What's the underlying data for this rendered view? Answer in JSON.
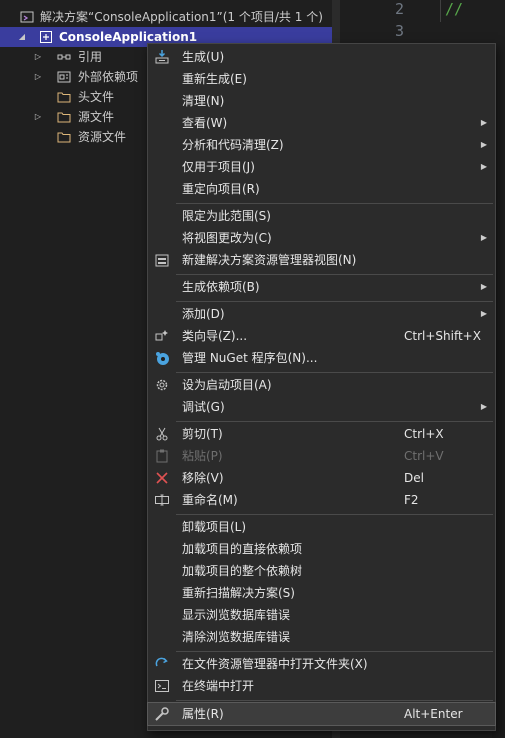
{
  "explorer": {
    "solution_label": "解决方案“ConsoleApplication1”(1 个项目/共 1 个)",
    "project_label": "ConsoleApplication1",
    "nodes": [
      {
        "label": "引用"
      },
      {
        "label": "外部依赖项"
      },
      {
        "label": "头文件"
      },
      {
        "label": "源文件"
      },
      {
        "label": "资源文件"
      }
    ]
  },
  "editor": {
    "line_numbers": [
      "2",
      "3"
    ],
    "comment_fragment": "//"
  },
  "menu": {
    "items": [
      {
        "label": "生成(U)",
        "shortcut": "",
        "icon": "build-icon"
      },
      {
        "label": "重新生成(E)",
        "shortcut": ""
      },
      {
        "label": "清理(N)",
        "shortcut": ""
      },
      {
        "label": "查看(W)",
        "shortcut": "",
        "submenu": true
      },
      {
        "label": "分析和代码清理(Z)",
        "shortcut": "",
        "submenu": true
      },
      {
        "label": "仅用于项目(J)",
        "shortcut": "",
        "submenu": true
      },
      {
        "label": "重定向项目(R)",
        "shortcut": ""
      },
      {
        "label": "限定为此范围(S)",
        "shortcut": ""
      },
      {
        "label": "将视图更改为(C)",
        "shortcut": "",
        "submenu": true
      },
      {
        "label": "新建解决方案资源管理器视图(N)",
        "shortcut": "",
        "icon": "new-view-icon"
      },
      {
        "label": "生成依赖项(B)",
        "shortcut": "",
        "submenu": true
      },
      {
        "label": "添加(D)",
        "shortcut": "",
        "submenu": true
      },
      {
        "label": "类向导(Z)...",
        "shortcut": "Ctrl+Shift+X",
        "icon": "class-wizard-icon"
      },
      {
        "label": "管理 NuGet 程序包(N)...",
        "shortcut": "",
        "icon": "nuget-icon"
      },
      {
        "label": "设为启动项目(A)",
        "shortcut": "",
        "icon": "gear-icon"
      },
      {
        "label": "调试(G)",
        "shortcut": "",
        "submenu": true
      },
      {
        "label": "剪切(T)",
        "shortcut": "Ctrl+X",
        "icon": "scissors-icon"
      },
      {
        "label": "粘贴(P)",
        "shortcut": "Ctrl+V",
        "icon": "paste-icon",
        "disabled": true
      },
      {
        "label": "移除(V)",
        "shortcut": "Del",
        "icon": "remove-x-icon"
      },
      {
        "label": "重命名(M)",
        "shortcut": "F2",
        "icon": "rename-icon"
      },
      {
        "label": "卸载项目(L)",
        "shortcut": ""
      },
      {
        "label": "加载项目的直接依赖项",
        "shortcut": ""
      },
      {
        "label": "加载项目的整个依赖树",
        "shortcut": ""
      },
      {
        "label": "重新扫描解决方案(S)",
        "shortcut": ""
      },
      {
        "label": "显示浏览数据库错误",
        "shortcut": ""
      },
      {
        "label": "清除浏览数据库错误",
        "shortcut": ""
      },
      {
        "label": "在文件资源管理器中打开文件夹(X)",
        "shortcut": "",
        "icon": "refresh-arrow-icon"
      },
      {
        "label": "在终端中打开",
        "shortcut": "",
        "icon": "terminal-icon"
      },
      {
        "label": "属性(R)",
        "shortcut": "Alt+Enter",
        "icon": "wrench-icon"
      }
    ]
  },
  "colors": {
    "menu_bg": "#2b2b2b",
    "selection": "#3a3d9e",
    "remove_red": "#e05252",
    "refresh_blue": "#4aa3df"
  }
}
